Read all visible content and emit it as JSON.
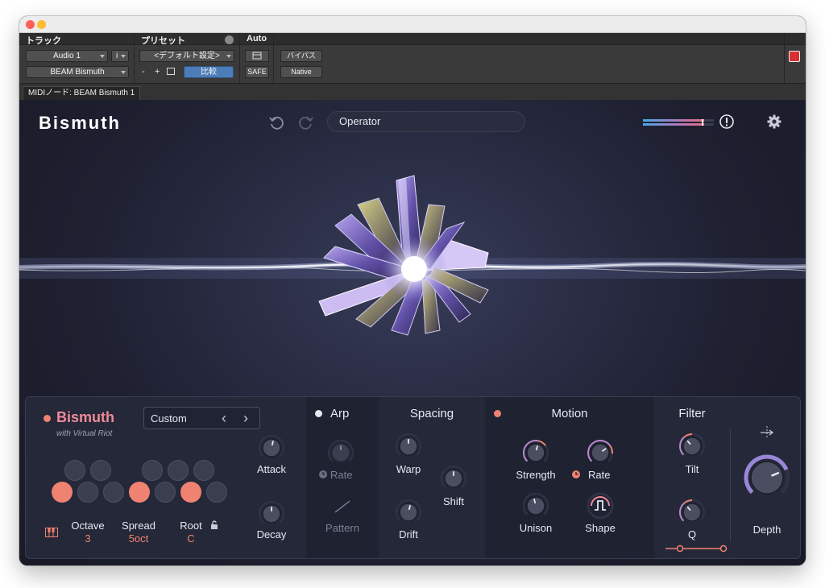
{
  "host": {
    "track_header": "トラック",
    "preset_header": "プリセット",
    "auto_header": "Auto",
    "track_name": "Audio 1",
    "track_i": "i",
    "insert_name": "BEAM Bismuth",
    "preset_value": "<デフォルト設定>",
    "minus": "-",
    "plus": "+",
    "compare": "比較",
    "safe": "SAFE",
    "bypass": "バイパス",
    "native": "Native",
    "midi_node": "MIDIノード: BEAM Bismuth 1"
  },
  "plugin": {
    "logo": "Bismuth",
    "preset_name": "Operator",
    "colors": {
      "accent": "#ef8270",
      "bg": "#1e2031",
      "panel": "#252838"
    },
    "icons": [
      "undo-icon",
      "redo-icon",
      "alert-icon",
      "gear-icon",
      "piano-icon",
      "lock-icon",
      "clock-icon",
      "direction-icon",
      "pattern-icon",
      "square-wave-icon"
    ]
  },
  "panel": {
    "brand": {
      "title": "Bismuth",
      "subtitle": "with Virtual Riot",
      "chord_preset": "Custom",
      "prev": "‹",
      "next": "›"
    },
    "keys": {
      "upper": [
        false,
        false,
        false,
        false,
        false
      ],
      "lower": [
        true,
        false,
        false,
        true,
        false,
        true,
        false
      ]
    },
    "octave": {
      "label": "Octave",
      "value": "3"
    },
    "spread": {
      "label": "Spread",
      "value": "5oct"
    },
    "root": {
      "label": "Root",
      "value": "C"
    },
    "attack": {
      "label": "Attack",
      "level": 0.55
    },
    "decay": {
      "label": "Decay",
      "level": 0.5
    },
    "arp": {
      "title": "Arp",
      "rate_label": "Rate",
      "pattern_label": "Pattern",
      "rate_level": 0.5
    },
    "spacing": {
      "title": "Spacing",
      "warp_label": "Warp",
      "drift_label": "Drift",
      "shift_label": "Shift",
      "warp_level": 0.5,
      "drift_level": 0.55,
      "shift_level": 0.5
    },
    "motion": {
      "title": "Motion",
      "strength_label": "Strength",
      "rate_label": "Rate",
      "unison_label": "Unison",
      "shape_label": "Shape",
      "strength_level": 0.55,
      "rate_level": 0.7,
      "unison_level": 0.45
    },
    "filter": {
      "title": "Filter",
      "tilt_label": "Tilt",
      "q_label": "Q",
      "depth_label": "Depth",
      "tilt_level": 0.35,
      "q_level": 0.35,
      "depth_level": 0.75
    }
  }
}
